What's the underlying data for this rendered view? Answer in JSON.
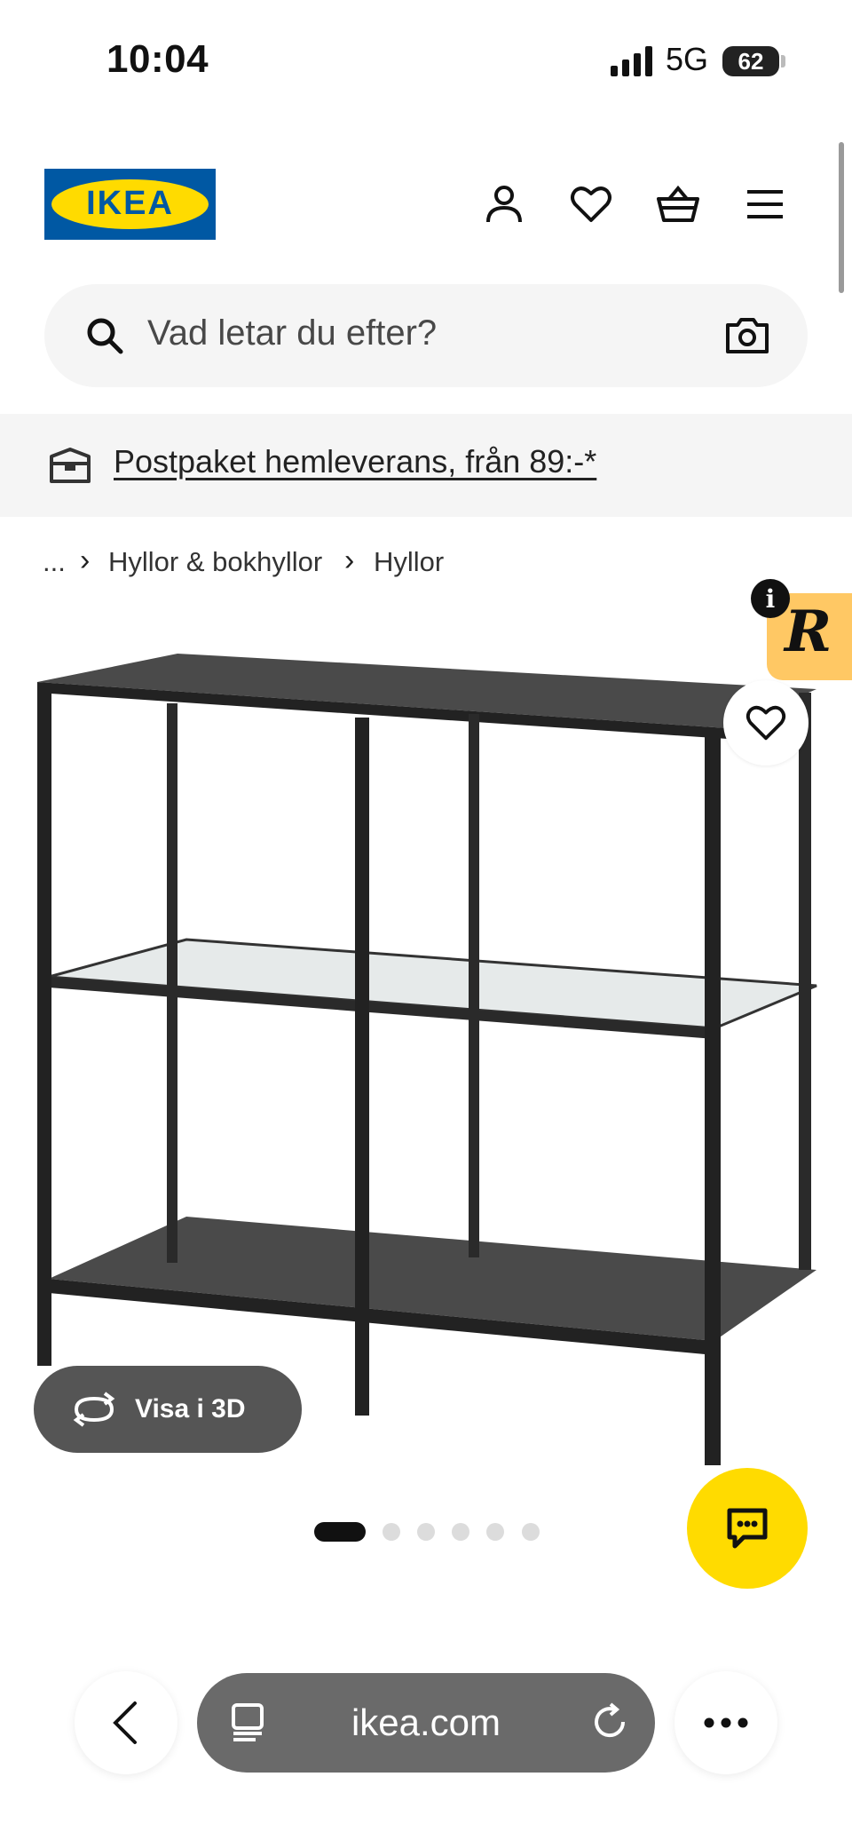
{
  "status_bar": {
    "time": "10:04",
    "network": "5G",
    "battery": "62"
  },
  "header": {
    "logo_text": "IKEA"
  },
  "search": {
    "placeholder": "Vad letar du efter?"
  },
  "banner": {
    "link_text": "Postpaket hemleverans, från 89:-*"
  },
  "breadcrumb": {
    "items": [
      "...",
      "Hyllor & bokhyllor",
      "Hyllor"
    ]
  },
  "product": {
    "view3d_label": "Visa i 3D",
    "image_count": 6,
    "active_image": 1
  },
  "badges": {
    "info": "i",
    "r_logo": "R"
  },
  "browser": {
    "url": "ikea.com"
  },
  "colors": {
    "ikea_blue": "#0058a3",
    "ikea_yellow": "#ffdb00",
    "badge_orange": "#ffc864"
  },
  "icons": [
    "signal-icon",
    "account-icon",
    "heart-icon",
    "basket-icon",
    "menu-icon",
    "search-icon",
    "camera-icon",
    "truck-icon",
    "rotate-3d-icon",
    "chat-icon",
    "back-icon",
    "reader-icon",
    "reload-icon",
    "more-icon"
  ]
}
